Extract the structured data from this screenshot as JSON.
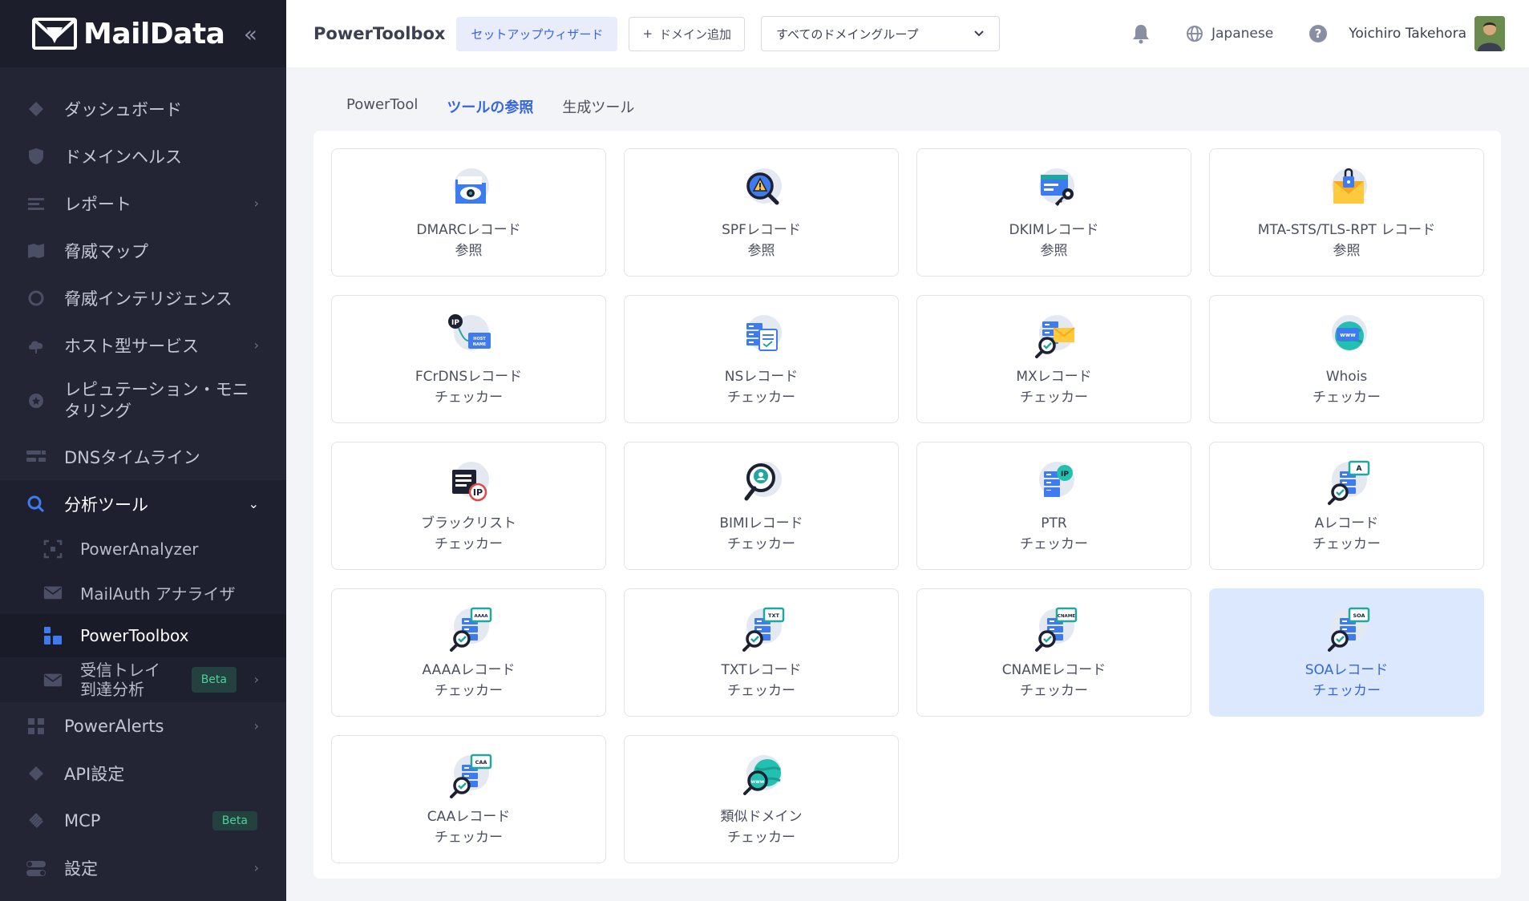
{
  "app": {
    "logo_text": "MailData",
    "collapse_glyph": "«"
  },
  "sidebar": {
    "items": [
      {
        "label": "ダッシュボード",
        "icon": "diamond-icon"
      },
      {
        "label": "ドメインヘルス",
        "icon": "shield-icon"
      },
      {
        "label": "レポート",
        "icon": "report-icon",
        "chevron": "›"
      },
      {
        "label": "脅威マップ",
        "icon": "map-icon"
      },
      {
        "label": "脅威インテリジェンス",
        "icon": "circle-icon"
      },
      {
        "label": "ホスト型サービス",
        "icon": "cloud-icon",
        "chevron": "›"
      },
      {
        "label": "レピュテーション・モニタリング",
        "icon": "badge-icon"
      },
      {
        "label": "DNSタイムライン",
        "icon": "timeline-icon"
      },
      {
        "label": "分析ツール",
        "icon": "search-icon",
        "chevron": "⌄"
      },
      {
        "label": "PowerAlerts",
        "icon": "grid-icon",
        "chevron": "›"
      },
      {
        "label": "API設定",
        "icon": "diamond-icon"
      },
      {
        "label": "MCP",
        "icon": "mcp-icon",
        "badge": "Beta"
      },
      {
        "label": "設定",
        "icon": "toggle-icon",
        "chevron": "›"
      }
    ],
    "subitems": [
      {
        "label": "PowerAnalyzer",
        "icon": "scan-icon"
      },
      {
        "label": "MailAuth アナライザ",
        "icon": "mail-icon"
      },
      {
        "label": "PowerToolbox",
        "icon": "toolbox-icon"
      },
      {
        "label": "受信トレイ到達分析",
        "icon": "mail-icon",
        "badge": "Beta",
        "chevron": "›"
      }
    ]
  },
  "header": {
    "brand": "PowerToolbox",
    "wizard_label": "セットアップウィザード",
    "add_domain_label": "ドメイン追加",
    "add_domain_glyph": "+",
    "group_select_value": "すべてのドメイングループ",
    "language": "Japanese",
    "user_name": "Yoichiro Takehora"
  },
  "tabs": [
    {
      "label": "PowerTool"
    },
    {
      "label": "ツールの参照"
    },
    {
      "label": "生成ツール"
    }
  ],
  "tools": [
    {
      "line1": "DMARCレコード",
      "line2": "参照",
      "icon": "dmarc-eye-icon"
    },
    {
      "line1": "SPFレコード",
      "line2": "参照",
      "icon": "spf-warning-icon"
    },
    {
      "line1": "DKIMレコード",
      "line2": "参照",
      "icon": "dkim-key-icon"
    },
    {
      "line1": "MTA-STS/TLS-RPT レコード",
      "line2": "参照",
      "icon": "mta-sts-lock-icon"
    },
    {
      "line1": "FCrDNSレコード",
      "line2": "チェッカー",
      "icon": "fcrdns-icon",
      "label_text": "IP",
      "label_text2": "HOST NAME"
    },
    {
      "line1": "NSレコード",
      "line2": "チェッカー",
      "icon": "ns-server-icon"
    },
    {
      "line1": "MXレコード",
      "line2": "チェッカー",
      "icon": "mx-mail-icon"
    },
    {
      "line1": "Whois",
      "line2": "チェッカー",
      "icon": "whois-globe-icon",
      "label_text": "www"
    },
    {
      "line1": "ブラックリスト",
      "line2": "チェッカー",
      "icon": "blacklist-icon",
      "label_text": "IP"
    },
    {
      "line1": "BIMIレコード",
      "line2": "チェッカー",
      "icon": "bimi-icon"
    },
    {
      "line1": "PTR",
      "line2": "チェッカー",
      "icon": "ptr-server-icon",
      "label_text": "IP"
    },
    {
      "line1": "Aレコード",
      "line2": "チェッカー",
      "icon": "a-record-icon",
      "label_text": "A"
    },
    {
      "line1": "AAAAレコード",
      "line2": "チェッカー",
      "icon": "aaaa-record-icon",
      "label_text": "AAAA"
    },
    {
      "line1": "TXTレコード",
      "line2": "チェッカー",
      "icon": "txt-record-icon",
      "label_text": "TXT"
    },
    {
      "line1": "CNAMEレコード",
      "line2": "チェッカー",
      "icon": "cname-record-icon",
      "label_text": "CNAME"
    },
    {
      "line1": "SOAレコード",
      "line2": "チェッカー",
      "icon": "soa-record-icon",
      "label_text": "SOA",
      "selected": true
    },
    {
      "line1": "CAAレコード",
      "line2": "チェッカー",
      "icon": "caa-record-icon",
      "label_text": "CAA"
    },
    {
      "line1": "類似ドメイン",
      "line2": "チェッカー",
      "icon": "similar-domain-icon",
      "label_text": "www"
    }
  ],
  "colors": {
    "sidebar_bg": "#232535",
    "accent": "#3566e0",
    "selected_card": "#dce8fd",
    "beta_text": "#4fcf9c"
  }
}
